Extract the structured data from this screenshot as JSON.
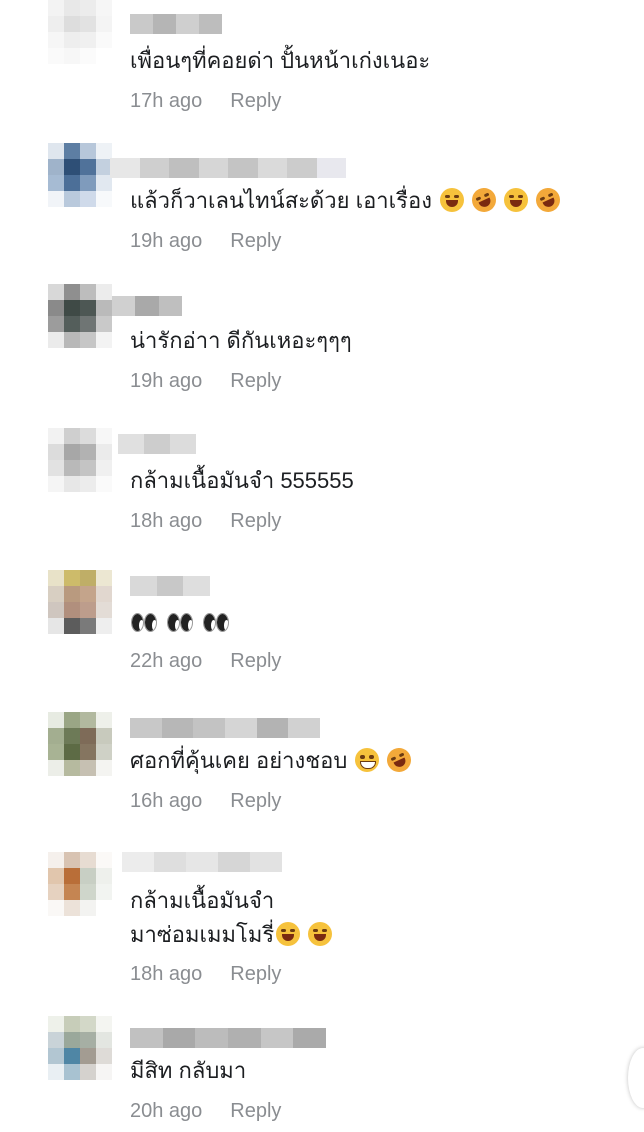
{
  "reply_label": "Reply",
  "comments": [
    {
      "text": "เพื่อนๆที่คอยด่า ปั้นหน้าเก่งเนอะ",
      "time": "17h ago"
    },
    {
      "text": "แล้วก็วาเลนไทน์สะด้วย เอาเรื่อง",
      "time": "19h ago",
      "emoji": [
        "joy-tears-icon",
        "rofl-icon",
        "joy-tears-icon",
        "rofl-icon"
      ]
    },
    {
      "text": "น่ารักอ่าา ดีกันเหอะๆๆๆ",
      "time": "19h ago"
    },
    {
      "text": "กล้ามเนื้อมันจำ 555555",
      "time": "18h ago"
    },
    {
      "text": "",
      "time": "22h ago",
      "emoji": [
        "eyes-icon",
        "eyes-icon",
        "eyes-icon"
      ]
    },
    {
      "text": "ศอกที่คุ้นเคย อย่างชอบ",
      "time": "16h ago",
      "emoji": [
        "grinning-sweat-icon",
        "rofl-icon"
      ]
    },
    {
      "text_line1": "กล้ามเนื้อมันจำ",
      "text_line2": "มาซ่อมเมมโมรี่",
      "time": "18h ago",
      "emoji": [
        "joy-tears-icon",
        "joy-tears-icon"
      ]
    },
    {
      "text": "มีสิท กลับมา",
      "time": "20h ago"
    }
  ]
}
